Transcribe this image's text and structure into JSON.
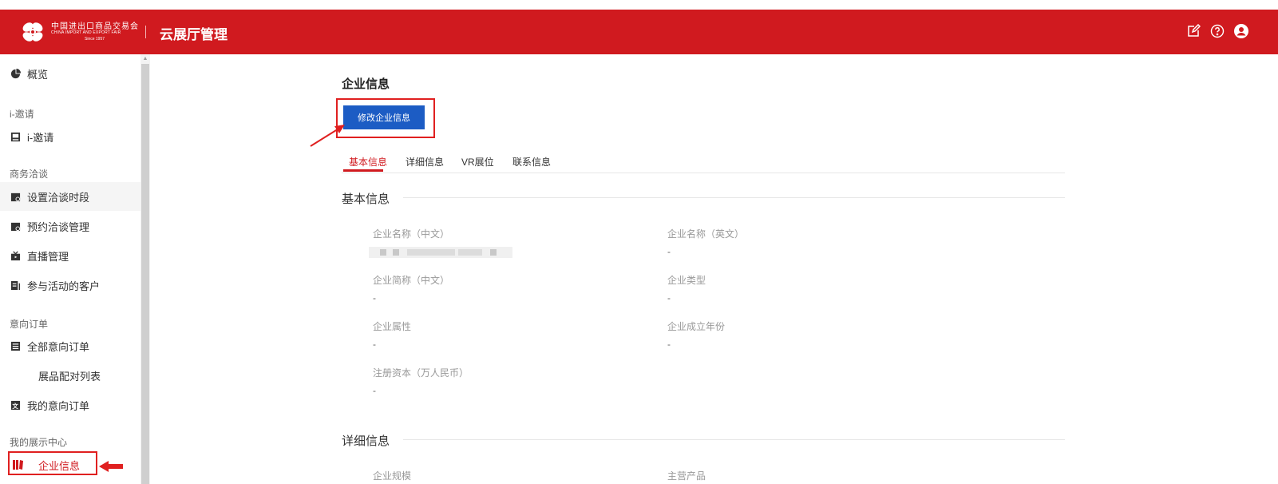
{
  "header": {
    "logo_cn": "中国进出口商品交易会",
    "logo_en": "CHINA IMPORT AND EXPORT FAIR",
    "logo_since": "Since 1957",
    "app_title": "云展厅管理",
    "icons": [
      "edit-icon",
      "help-icon",
      "user-icon"
    ]
  },
  "sidebar": {
    "overview": "概览",
    "group_invite": "i-邀请",
    "invite": "i-邀请",
    "group_negotiation": "商务洽谈",
    "set_time_slots": "设置洽谈时段",
    "booking_management": "预约洽谈管理",
    "live_management": "直播管理",
    "event_customers": "参与活动的客户",
    "group_orders": "意向订单",
    "all_orders": "全部意向订单",
    "product_matching": "展品配对列表",
    "my_orders": "我的意向订单",
    "group_showcase": "我的展示中心",
    "company_info": "企业信息"
  },
  "main": {
    "heading": "企业信息",
    "edit_button": "修改企业信息",
    "tabs": [
      "基本信息",
      "详细信息",
      "VR展位",
      "联系信息"
    ],
    "active_tab": "基本信息",
    "section_basic": "基本信息",
    "section_detail": "详细信息",
    "fields": {
      "name_cn_label": "企业名称（中文）",
      "name_en_label": "企业名称（英文）",
      "name_en_value": "-",
      "short_cn_label": "企业简称（中文）",
      "short_cn_value": "-",
      "type_label": "企业类型",
      "type_value": "-",
      "attr_label": "企业属性",
      "attr_value": "-",
      "founded_label": "企业成立年份",
      "founded_value": "-",
      "capital_label": "注册资本（万人民币）",
      "capital_value": "-",
      "scale_label": "企业规模",
      "products_label": "主营产品"
    }
  },
  "colors": {
    "header_bg": "#d01a1f",
    "primary_button": "#1c5cc4",
    "highlight_border": "#e02020"
  }
}
